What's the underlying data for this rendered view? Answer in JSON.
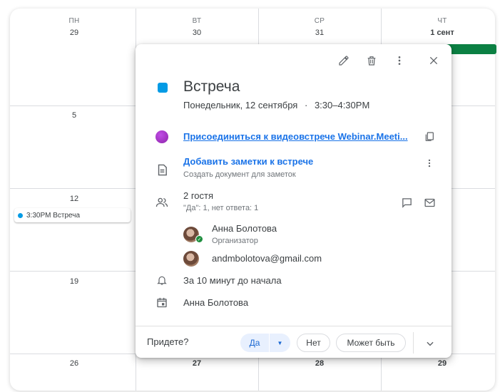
{
  "calendar": {
    "days": [
      {
        "dow": "ПН",
        "date": "29"
      },
      {
        "dow": "ВТ",
        "date": "30"
      },
      {
        "dow": "СР",
        "date": "31"
      },
      {
        "dow": "ЧТ",
        "date": "1 сент"
      }
    ],
    "weeks": [
      {
        "dates": [
          "5",
          "",
          "",
          ""
        ]
      },
      {
        "dates": [
          "12",
          "",
          "",
          ""
        ]
      },
      {
        "dates": [
          "19",
          "",
          "",
          ""
        ]
      },
      {
        "dates": [
          "26",
          "27",
          "28",
          "29"
        ]
      }
    ],
    "event_chip": "3:30PM Встреча",
    "colors": {
      "event": "#039be5",
      "green_event": "#0b8043",
      "accent": "#1a73e8"
    }
  },
  "popup": {
    "toolbar": {
      "edit_icon": "pencil-icon",
      "delete_icon": "trash-icon",
      "more_icon": "more-vert-icon",
      "close_icon": "close-icon"
    },
    "title": "Встреча",
    "datetime": "Понедельник, 12 сентября",
    "separator": "·",
    "time": "3:30–4:30PM",
    "video_link": "Присоединиться к видеовстрече Webinar.Meeti...",
    "notes_link": "Добавить заметки к встрече",
    "notes_hint": "Создать документ для заметок",
    "guests_title": "2 гостя",
    "guests_summary": "\"Да\": 1, нет ответа: 1",
    "guests": [
      {
        "name": "Анна Болотова",
        "role": "Организатор"
      },
      {
        "name": "andmbolotova@gmail.com",
        "role": ""
      }
    ],
    "reminder": "За 10 минут до начала",
    "calendar_owner": "Анна Болотова",
    "footer": {
      "question": "Придете?",
      "yes": "Да",
      "no": "Нет",
      "maybe": "Может быть"
    }
  }
}
